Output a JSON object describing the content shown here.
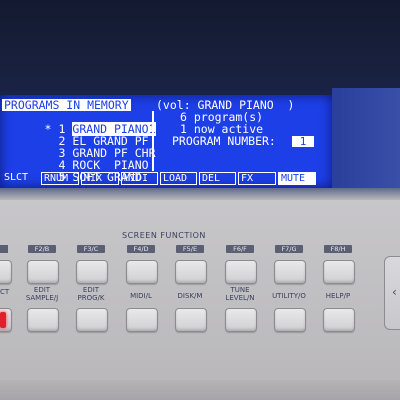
{
  "lcd": {
    "header_left": "PROGRAMS IN MEMORY",
    "header_right": "(vol: GRAND PIANO  )",
    "programs": [
      {
        "marker": "*",
        "number": "1",
        "name": "GRAND PIANO1",
        "selected": true
      },
      {
        "marker": "",
        "number": "2",
        "name": "EL GRAND PF",
        "selected": false
      },
      {
        "marker": "",
        "number": "3",
        "name": "GRAND PF CHR",
        "selected": false
      },
      {
        "marker": "",
        "number": "4",
        "name": "ROCK  PIANO",
        "selected": false
      },
      {
        "marker": "",
        "number": "5",
        "name": "SOFT GRAND",
        "selected": false
      }
    ],
    "program_count": "6 program(s)",
    "active_count": "1 now active",
    "program_number_label": "PROGRAM NUMBER:",
    "program_number_value": "1",
    "softkeys": [
      {
        "label": "SLCT",
        "active": false
      },
      {
        "label": "RNUM",
        "active": false
      },
      {
        "label": "MIX",
        "active": false
      },
      {
        "label": "MIDI",
        "active": false
      },
      {
        "label": "LOAD",
        "active": false
      },
      {
        "label": "DEL",
        "active": false
      },
      {
        "label": "FX",
        "active": false
      },
      {
        "label": "MUTE",
        "active": true
      }
    ]
  },
  "panel": {
    "section_title": "SCREEN FUNCTION",
    "fkeys": [
      "F2/B",
      "F3/C",
      "F4/D",
      "F5/E",
      "F6/F",
      "F7/G",
      "F8/H"
    ],
    "functions": [
      "EDIT\nSAMPLE/J",
      "EDIT\nPROG/K",
      "MIDI/L",
      "DISK/M",
      "TUNE\nLEVEL/N",
      "UTILITY/O",
      "HELP/P"
    ],
    "edge_function": "CT",
    "colors": {
      "lcd": "#1d3fe8",
      "led": "#e0202a"
    }
  }
}
